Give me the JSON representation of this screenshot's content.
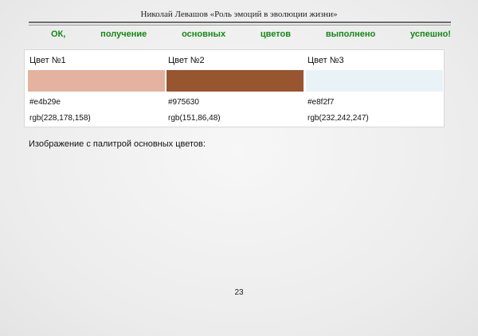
{
  "header": {
    "title": "Николай Левашов «Роль эмоций в эволюции жизни»"
  },
  "status": {
    "words": [
      "ОК,",
      "получение",
      "основных",
      "цветов",
      "выполнено",
      "успешно!"
    ],
    "color": "#128a12"
  },
  "colors": [
    {
      "name": "Цвет №1",
      "hex": "#e4b29e",
      "rgb": "rgb(228,178,158)"
    },
    {
      "name": "Цвет №2",
      "hex": "#975630",
      "rgb": "rgb(151,86,48)"
    },
    {
      "name": "Цвет №3",
      "hex": "#e8f2f7",
      "rgb": "rgb(232,242,247)"
    }
  ],
  "palette_label": "Изображение с палитрой основных цветов:",
  "page_number": "23"
}
